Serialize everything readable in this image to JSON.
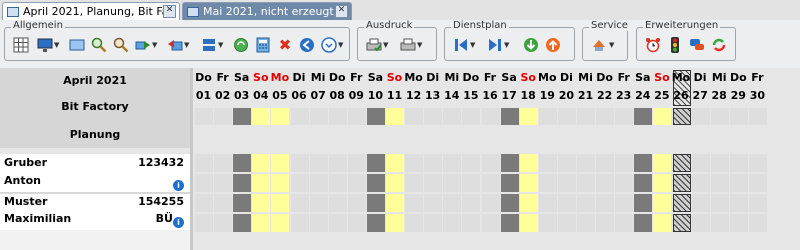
{
  "tabs": [
    {
      "label": "April 2021, Planung, Bit Facto...",
      "active": true
    },
    {
      "label": "Mai 2021, nicht erzeugt, Bit F...",
      "active": false
    }
  ],
  "toolbar": {
    "groups": [
      {
        "title": "Allgemein"
      },
      {
        "title": "Ausdruck"
      },
      {
        "title": "Dienstplan"
      },
      {
        "title": "Service"
      },
      {
        "title": "Erweiterungen"
      }
    ]
  },
  "header": {
    "month": "April 2021",
    "company": "Bit Factory",
    "status": "Planung"
  },
  "employees": [
    {
      "last": "Gruber",
      "first": "Anton",
      "id": "123432",
      "code": ""
    },
    {
      "last": "Muster",
      "first": "Maximilian",
      "id": "154255",
      "code": "BÜ"
    }
  ],
  "days": [
    {
      "wd": "Do",
      "n": "01",
      "type": "w"
    },
    {
      "wd": "Fr",
      "n": "02",
      "type": "w"
    },
    {
      "wd": "Sa",
      "n": "03",
      "type": "sat"
    },
    {
      "wd": "So",
      "n": "04",
      "type": "sun"
    },
    {
      "wd": "Mo",
      "n": "05",
      "type": "holiday"
    },
    {
      "wd": "Di",
      "n": "06",
      "type": "w"
    },
    {
      "wd": "Mi",
      "n": "07",
      "type": "w"
    },
    {
      "wd": "Do",
      "n": "08",
      "type": "w"
    },
    {
      "wd": "Fr",
      "n": "09",
      "type": "w"
    },
    {
      "wd": "Sa",
      "n": "10",
      "type": "sat"
    },
    {
      "wd": "So",
      "n": "11",
      "type": "sun"
    },
    {
      "wd": "Mo",
      "n": "12",
      "type": "w"
    },
    {
      "wd": "Di",
      "n": "13",
      "type": "w"
    },
    {
      "wd": "Mi",
      "n": "14",
      "type": "w"
    },
    {
      "wd": "Do",
      "n": "15",
      "type": "w"
    },
    {
      "wd": "Fr",
      "n": "16",
      "type": "w"
    },
    {
      "wd": "Sa",
      "n": "17",
      "type": "sat"
    },
    {
      "wd": "So",
      "n": "18",
      "type": "sun"
    },
    {
      "wd": "Mo",
      "n": "19",
      "type": "w"
    },
    {
      "wd": "Di",
      "n": "20",
      "type": "w"
    },
    {
      "wd": "Mi",
      "n": "21",
      "type": "w"
    },
    {
      "wd": "Do",
      "n": "22",
      "type": "w"
    },
    {
      "wd": "Fr",
      "n": "23",
      "type": "w"
    },
    {
      "wd": "Sa",
      "n": "24",
      "type": "sat"
    },
    {
      "wd": "So",
      "n": "25",
      "type": "sun"
    },
    {
      "wd": "Mo",
      "n": "26",
      "type": "today"
    },
    {
      "wd": "Di",
      "n": "27",
      "type": "w"
    },
    {
      "wd": "Mi",
      "n": "28",
      "type": "w"
    },
    {
      "wd": "Do",
      "n": "29",
      "type": "w"
    },
    {
      "wd": "Fr",
      "n": "30",
      "type": "w"
    }
  ],
  "colors": {
    "saturday": "#7a7a7a",
    "sunday": "#ffff99",
    "holiday_text": "#e00000",
    "tab_inactive": "#6f8aa8",
    "info_badge": "#1f6fd0"
  }
}
